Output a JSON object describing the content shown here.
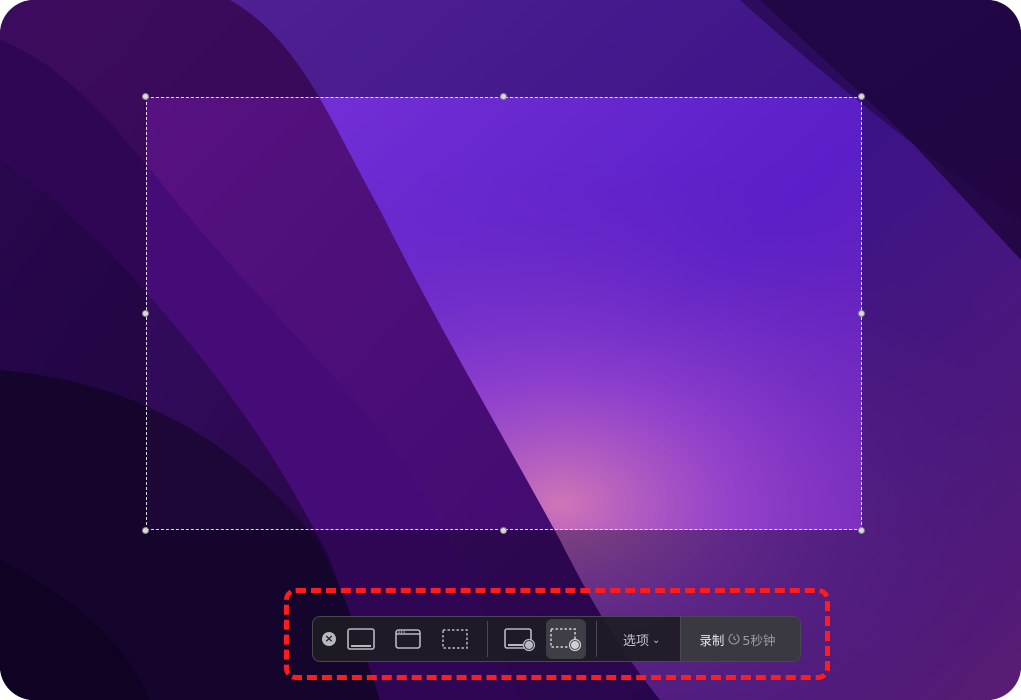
{
  "toolbar": {
    "close_icon": "close-icon",
    "buttons": [
      {
        "name": "capture-entire-screen",
        "icon": "full-screen-icon",
        "active": false
      },
      {
        "name": "capture-window",
        "icon": "window-icon",
        "active": false
      },
      {
        "name": "capture-selection",
        "icon": "selection-icon",
        "active": false
      },
      {
        "name": "record-entire-screen",
        "icon": "record-screen-icon",
        "active": false
      },
      {
        "name": "record-selection",
        "icon": "record-selection-icon",
        "active": true
      }
    ],
    "options_label": "选项",
    "record_label": "录制",
    "timer_label": "5秒钟"
  },
  "colors": {
    "annotation": "#ff1c1c",
    "toolbar_bg": "#1e1c24",
    "selection_border": "#ffffff"
  }
}
